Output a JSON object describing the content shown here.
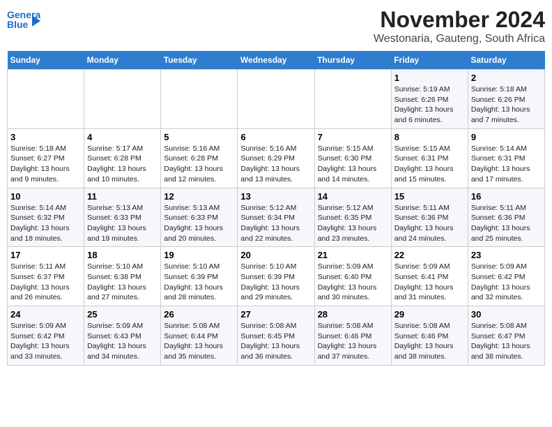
{
  "logo": {
    "line1": "General",
    "line2": "Blue"
  },
  "title": "November 2024",
  "subtitle": "Westonaria, Gauteng, South Africa",
  "days_of_week": [
    "Sunday",
    "Monday",
    "Tuesday",
    "Wednesday",
    "Thursday",
    "Friday",
    "Saturday"
  ],
  "weeks": [
    [
      {
        "day": "",
        "content": ""
      },
      {
        "day": "",
        "content": ""
      },
      {
        "day": "",
        "content": ""
      },
      {
        "day": "",
        "content": ""
      },
      {
        "day": "",
        "content": ""
      },
      {
        "day": "1",
        "content": "Sunrise: 5:19 AM\nSunset: 6:26 PM\nDaylight: 13 hours and 6 minutes."
      },
      {
        "day": "2",
        "content": "Sunrise: 5:18 AM\nSunset: 6:26 PM\nDaylight: 13 hours and 7 minutes."
      }
    ],
    [
      {
        "day": "3",
        "content": "Sunrise: 5:18 AM\nSunset: 6:27 PM\nDaylight: 13 hours and 9 minutes."
      },
      {
        "day": "4",
        "content": "Sunrise: 5:17 AM\nSunset: 6:28 PM\nDaylight: 13 hours and 10 minutes."
      },
      {
        "day": "5",
        "content": "Sunrise: 5:16 AM\nSunset: 6:28 PM\nDaylight: 13 hours and 12 minutes."
      },
      {
        "day": "6",
        "content": "Sunrise: 5:16 AM\nSunset: 6:29 PM\nDaylight: 13 hours and 13 minutes."
      },
      {
        "day": "7",
        "content": "Sunrise: 5:15 AM\nSunset: 6:30 PM\nDaylight: 13 hours and 14 minutes."
      },
      {
        "day": "8",
        "content": "Sunrise: 5:15 AM\nSunset: 6:31 PM\nDaylight: 13 hours and 15 minutes."
      },
      {
        "day": "9",
        "content": "Sunrise: 5:14 AM\nSunset: 6:31 PM\nDaylight: 13 hours and 17 minutes."
      }
    ],
    [
      {
        "day": "10",
        "content": "Sunrise: 5:14 AM\nSunset: 6:32 PM\nDaylight: 13 hours and 18 minutes."
      },
      {
        "day": "11",
        "content": "Sunrise: 5:13 AM\nSunset: 6:33 PM\nDaylight: 13 hours and 19 minutes."
      },
      {
        "day": "12",
        "content": "Sunrise: 5:13 AM\nSunset: 6:33 PM\nDaylight: 13 hours and 20 minutes."
      },
      {
        "day": "13",
        "content": "Sunrise: 5:12 AM\nSunset: 6:34 PM\nDaylight: 13 hours and 22 minutes."
      },
      {
        "day": "14",
        "content": "Sunrise: 5:12 AM\nSunset: 6:35 PM\nDaylight: 13 hours and 23 minutes."
      },
      {
        "day": "15",
        "content": "Sunrise: 5:11 AM\nSunset: 6:36 PM\nDaylight: 13 hours and 24 minutes."
      },
      {
        "day": "16",
        "content": "Sunrise: 5:11 AM\nSunset: 6:36 PM\nDaylight: 13 hours and 25 minutes."
      }
    ],
    [
      {
        "day": "17",
        "content": "Sunrise: 5:11 AM\nSunset: 6:37 PM\nDaylight: 13 hours and 26 minutes."
      },
      {
        "day": "18",
        "content": "Sunrise: 5:10 AM\nSunset: 6:38 PM\nDaylight: 13 hours and 27 minutes."
      },
      {
        "day": "19",
        "content": "Sunrise: 5:10 AM\nSunset: 6:39 PM\nDaylight: 13 hours and 28 minutes."
      },
      {
        "day": "20",
        "content": "Sunrise: 5:10 AM\nSunset: 6:39 PM\nDaylight: 13 hours and 29 minutes."
      },
      {
        "day": "21",
        "content": "Sunrise: 5:09 AM\nSunset: 6:40 PM\nDaylight: 13 hours and 30 minutes."
      },
      {
        "day": "22",
        "content": "Sunrise: 5:09 AM\nSunset: 6:41 PM\nDaylight: 13 hours and 31 minutes."
      },
      {
        "day": "23",
        "content": "Sunrise: 5:09 AM\nSunset: 6:42 PM\nDaylight: 13 hours and 32 minutes."
      }
    ],
    [
      {
        "day": "24",
        "content": "Sunrise: 5:09 AM\nSunset: 6:42 PM\nDaylight: 13 hours and 33 minutes."
      },
      {
        "day": "25",
        "content": "Sunrise: 5:09 AM\nSunset: 6:43 PM\nDaylight: 13 hours and 34 minutes."
      },
      {
        "day": "26",
        "content": "Sunrise: 5:08 AM\nSunset: 6:44 PM\nDaylight: 13 hours and 35 minutes."
      },
      {
        "day": "27",
        "content": "Sunrise: 5:08 AM\nSunset: 6:45 PM\nDaylight: 13 hours and 36 minutes."
      },
      {
        "day": "28",
        "content": "Sunrise: 5:08 AM\nSunset: 6:46 PM\nDaylight: 13 hours and 37 minutes."
      },
      {
        "day": "29",
        "content": "Sunrise: 5:08 AM\nSunset: 6:46 PM\nDaylight: 13 hours and 38 minutes."
      },
      {
        "day": "30",
        "content": "Sunrise: 5:08 AM\nSunset: 6:47 PM\nDaylight: 13 hours and 38 minutes."
      }
    ]
  ]
}
